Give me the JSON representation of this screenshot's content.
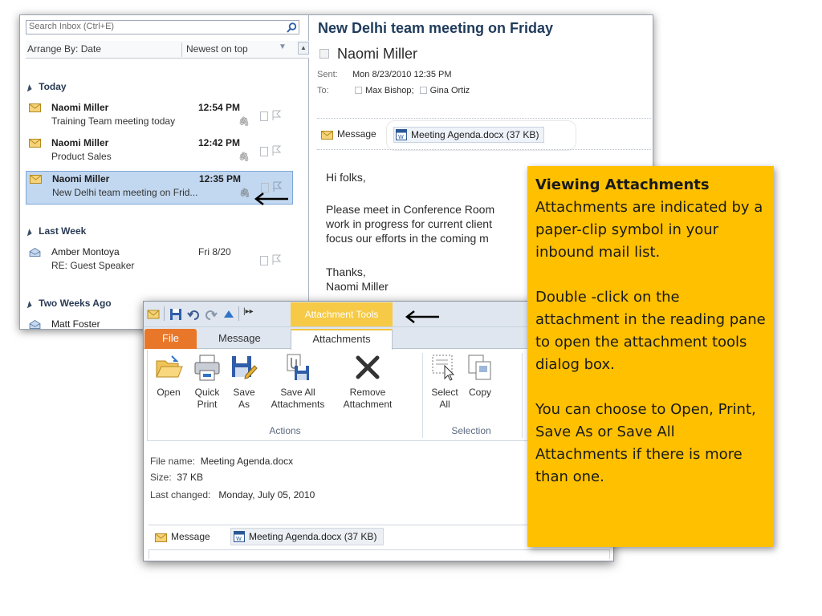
{
  "inbox": {
    "search_placeholder": "Search Inbox (Ctrl+E)",
    "arrange_by": "Arrange By: Date",
    "sort_order": "Newest on top",
    "groups": [
      {
        "label": "Today"
      },
      {
        "label": "Last Week"
      },
      {
        "label": "Two Weeks Ago"
      }
    ],
    "items": [
      {
        "sender": "Naomi Miller",
        "time": "12:54 PM",
        "subject": "Training Team meeting today",
        "attachment": true
      },
      {
        "sender": "Naomi Miller",
        "time": "12:42 PM",
        "subject": "Product Sales",
        "attachment": true
      },
      {
        "sender": "Naomi Miller",
        "time": "12:35 PM",
        "subject": "New Delhi team meeting on Frid...",
        "attachment": true,
        "selected": true
      },
      {
        "sender": "Amber Montoya",
        "time": "Fri 8/20",
        "subject": "RE: Guest Speaker",
        "attachment": false
      },
      {
        "sender": "Matt Foster",
        "time": "",
        "subject": "",
        "attachment": false
      }
    ]
  },
  "reading": {
    "subject": "New Delhi team meeting on Friday",
    "from": "Naomi Miller",
    "sent_label": "Sent:",
    "sent_value": "Mon 8/23/2010 12:35 PM",
    "to_label": "To:",
    "to_recipient_1": "Max Bishop;",
    "to_recipient_2": "Gina Ortiz",
    "message_tab": "Message",
    "attachment_chip": "Meeting Agenda.docx (37 KB)",
    "body": {
      "greeting": "Hi folks,",
      "line1": "Please meet in Conference Room",
      "line2": "work in progress for current client",
      "line3": "focus our efforts in the coming m",
      "signoff": "Thanks,",
      "signature": "Naomi Miller"
    }
  },
  "attachment_tools": {
    "context_tab_title": "Attachment Tools",
    "tabs": {
      "file": "File",
      "message": "Message",
      "attachments": "Attachments"
    },
    "buttons": {
      "open": "Open",
      "quick_print_1": "Quick",
      "quick_print_2": "Print",
      "save_as_1": "Save",
      "save_as_2": "As",
      "save_all_1": "Save All",
      "save_all_2": "Attachments",
      "remove_1": "Remove",
      "remove_2": "Attachment",
      "select_all_1": "Select",
      "select_all_2": "All",
      "copy": "Copy"
    },
    "groups": {
      "actions": "Actions",
      "selection": "Selection"
    },
    "file_info": {
      "file_name_label": "File name:",
      "file_name_value": "Meeting Agenda.docx",
      "size_label": "Size:",
      "size_value": "37 KB",
      "last_changed_label": "Last changed:",
      "last_changed_value": "Monday, July 05, 2010"
    },
    "message_tab": "Message",
    "attachment_chip": "Meeting Agenda.docx (37 KB)"
  },
  "callout": {
    "title": "Viewing Attachments",
    "p1": "Attachments are indicated by a paper-clip symbol in your inbound mail list.",
    "p2": "Double -click on the attachment in the reading pane to open the attachment tools dialog box.",
    "p3": "You can choose to Open, Print, Save As or Save All Attachments if there is more than one."
  },
  "colors": {
    "callout_bg": "#ffc000",
    "context_tab": "#f6ca46",
    "file_tab": "#e9772a",
    "selected_row": "#c2d8f0"
  }
}
